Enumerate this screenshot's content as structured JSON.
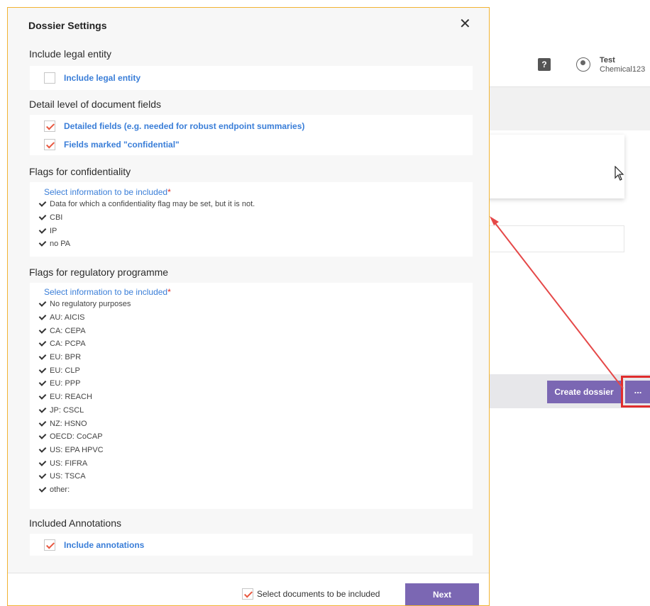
{
  "background": {
    "user": {
      "name": "Test",
      "organization": "Chemical123"
    },
    "buttons": {
      "create_dossier": "Create dossier",
      "more": "..."
    }
  },
  "modal": {
    "title": "Dossier Settings",
    "sections": {
      "legal_entity": {
        "title": "Include legal entity",
        "options": [
          {
            "label": "Include legal entity",
            "checked": false
          }
        ]
      },
      "detail_level": {
        "title": "Detail level of document fields",
        "options": [
          {
            "label": "Detailed fields (e.g. needed for robust endpoint summaries)",
            "checked": true
          },
          {
            "label": "Fields marked \"confidential\"",
            "checked": true
          }
        ]
      },
      "confidentiality": {
        "title": "Flags for confidentiality",
        "select_label": "Select information to be included",
        "required_mark": "*",
        "items": [
          "Data for which a confidentiality flag may be set, but it is not.",
          "CBI",
          "IP",
          "no PA"
        ]
      },
      "regulatory": {
        "title": "Flags for regulatory programme",
        "select_label": "Select information to be included",
        "required_mark": "*",
        "items": [
          "No regulatory purposes",
          "AU: AICIS",
          "CA: CEPA",
          "CA: PCPA",
          "EU: BPR",
          "EU: CLP",
          "EU: PPP",
          "EU: REACH",
          "JP: CSCL",
          "NZ: HSNO",
          "OECD: CoCAP",
          "US: EPA HPVC",
          "US: FIFRA",
          "US: TSCA",
          "other:"
        ]
      },
      "annotations": {
        "title": "Included Annotations",
        "options": [
          {
            "label": "Include annotations",
            "checked": true
          }
        ]
      }
    },
    "footer": {
      "select_documents_label": "Select documents to be included",
      "select_documents_checked": true,
      "next_label": "Next"
    }
  },
  "colors": {
    "accent_purple": "#7b67b3",
    "link_blue": "#3a7ed8",
    "checkmark_orange": "#e8573f",
    "highlight_red": "#e02d2d",
    "modal_border": "#f1b333"
  }
}
